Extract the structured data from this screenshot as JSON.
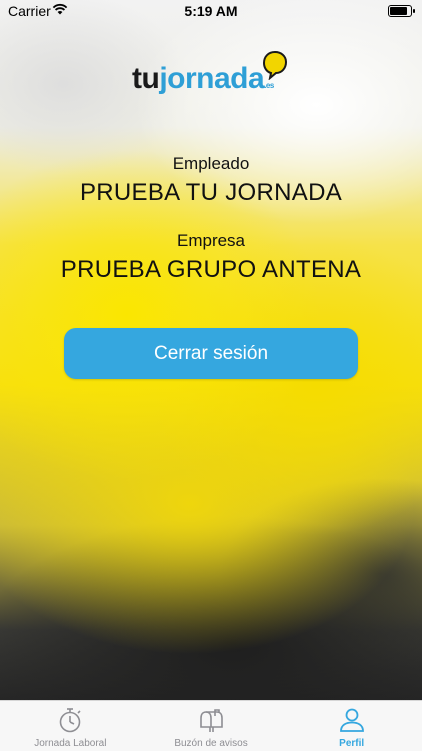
{
  "status_bar": {
    "carrier": "Carrier",
    "time": "5:19 AM"
  },
  "logo": {
    "tu": "tu",
    "jornada": "jornada",
    "suffix": ".es"
  },
  "profile": {
    "employee_label": "Empleado",
    "employee_name": "PRUEBA TU JORNADA",
    "company_label": "Empresa",
    "company_name": "PRUEBA GRUPO ANTENA"
  },
  "logout_button": {
    "label": "Cerrar sesión"
  },
  "tabbar": {
    "items": [
      {
        "label": "Jornada Laboral",
        "icon": "stopwatch-icon",
        "active": false
      },
      {
        "label": "Buzón de avisos",
        "icon": "mailbox-icon",
        "active": false
      },
      {
        "label": "Perfil",
        "icon": "person-icon",
        "active": true
      }
    ]
  },
  "colors": {
    "accent": "#35a7df",
    "logo_dark": "#1a1a1a"
  }
}
